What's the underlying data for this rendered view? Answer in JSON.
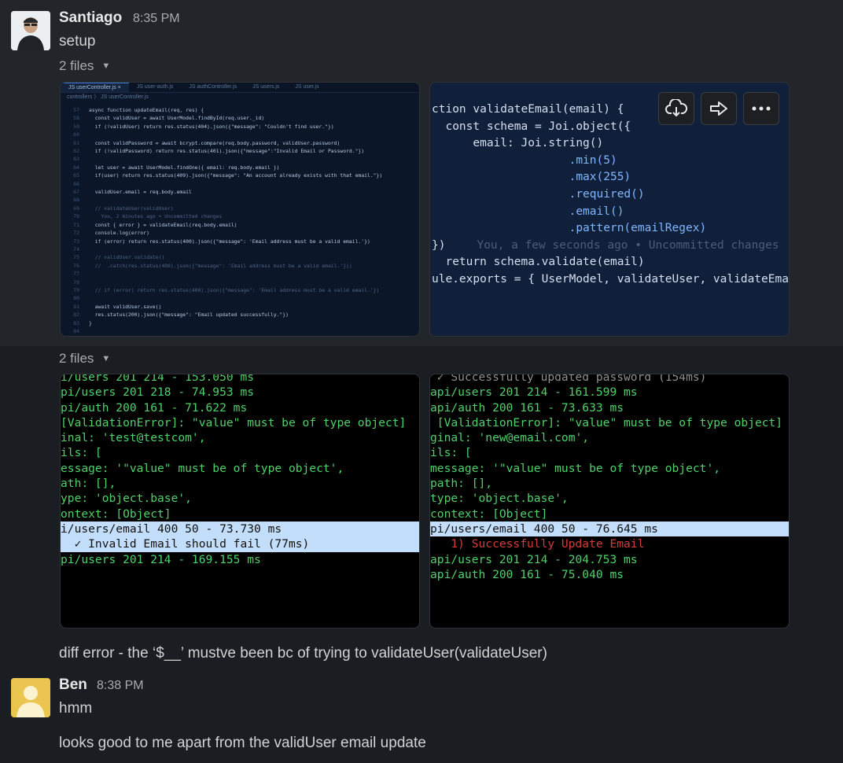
{
  "messages": [
    {
      "author": "Santiago",
      "time": "8:35 PM",
      "text": "setup"
    },
    {
      "text": "diff error - the ‘$__’ mustve been bc of trying to validateUser(validateUser)"
    },
    {
      "author": "Ben",
      "time": "8:38 PM",
      "text": "hmm"
    },
    {
      "text": "looks good to me apart from the validUser email update"
    }
  ],
  "file_groups": [
    {
      "label": "2 files"
    },
    {
      "label": "2 files"
    }
  ],
  "shot1": {
    "tabs": [
      "userController.js",
      "user-auth.js",
      "authController.js",
      "users.js",
      "user.js"
    ],
    "breadcrumb": "controllers 〉 JS userController.js",
    "lines": [
      {
        "n": "57",
        "t": "async function updateEmail(req, res) {"
      },
      {
        "n": "58",
        "t": "  const validUser = await UserModel.findById(req.user._id)"
      },
      {
        "n": "59",
        "t": "  if (!validUser) return res.status(404).json({\"message\": \"Couldn't find user.\"})"
      },
      {
        "n": "60",
        "t": ""
      },
      {
        "n": "61",
        "t": "  const validPassword = await bcrypt.compare(req.body.password, validUser.password)"
      },
      {
        "n": "62",
        "t": "  if (!validPassword) return res.status(401).json({\"message\":\"Invalid Email or Password.\"})"
      },
      {
        "n": "63",
        "t": ""
      },
      {
        "n": "64",
        "t": "  let user = await UserModel.findOne({ email: req.body.email })"
      },
      {
        "n": "65",
        "t": "  if(user) return res.status(409).json({\"message\": \"An account already exists with that email.\"})"
      },
      {
        "n": "66",
        "t": ""
      },
      {
        "n": "67",
        "t": "  validUser.email = req.body.email"
      },
      {
        "n": "68",
        "t": ""
      },
      {
        "n": "69",
        "t": "  // validateUser(validUser)"
      },
      {
        "n": "70",
        "t": "    You, 2 minutes ago • Uncommitted changes"
      },
      {
        "n": "71",
        "t": "  const { error } = validateEmail(req.body.email)"
      },
      {
        "n": "72",
        "t": "  console.log(error)"
      },
      {
        "n": "73",
        "t": "  if (error) return res.status(400).json({\"message\": 'Email address must be a valid email.'})"
      },
      {
        "n": "74",
        "t": ""
      },
      {
        "n": "75",
        "t": "  // validUser.validate()"
      },
      {
        "n": "76",
        "t": "  //  .catch(res.status(400).json({\"message\": 'Email address must be a valid email.'}))"
      },
      {
        "n": "77",
        "t": ""
      },
      {
        "n": "78",
        "t": ""
      },
      {
        "n": "79",
        "t": "  // if (error) return res.status(400).json({\"message\": 'Email address must be a valid email.'})"
      },
      {
        "n": "80",
        "t": ""
      },
      {
        "n": "81",
        "t": "  await validUser.save()"
      },
      {
        "n": "82",
        "t": "  res.status(200).json({\"message\": \"Email updated successfully.\"})"
      },
      {
        "n": "83",
        "t": "}"
      },
      {
        "n": "84",
        "t": ""
      }
    ]
  },
  "shot2": {
    "lines": [
      "ction validateEmail(email) {",
      "  const schema = Joi.object({",
      "      email: Joi.string()",
      "                    .min(5)",
      "                    .max(255)",
      "                    .required()",
      "                    .email()",
      "                    .pattern(emailRegex)",
      "})",
      "  return schema.validate(email)",
      "",
      "",
      "ule.exports = { UserModel, validateUser, validateEmai"
    ],
    "blame": "You, a few seconds ago • Uncommitted changes",
    "actions": [
      "download-icon",
      "share-icon",
      "more-icon"
    ]
  },
  "shot3": {
    "lines": [
      "i/users 201 214 - 153.050 ms",
      "pi/users 201 218 - 74.953 ms",
      "pi/auth 200 161 - 71.622 ms",
      "[ValidationError]: \"value\" must be of type object]",
      "inal: 'test@testcom',",
      "ils: [",
      "",
      "essage: '\"value\" must be of type object',",
      "ath: [],",
      "ype: 'object.base',",
      "ontext: [Object]",
      "",
      "",
      "",
      "i/users/email 400 50 - 73.730 ms",
      "  ✓ Invalid Email should fail (77ms)",
      "pi/users 201 214 - 169.155 ms"
    ]
  },
  "shot4": {
    "lines": [
      " ✓ Successfully updated password (154ms)",
      "api/users 201 214 - 161.599 ms",
      "api/auth 200 161 - 73.633 ms",
      " [ValidationError]: \"value\" must be of type object] {",
      "ginal: 'new@email.com',",
      "ils: [",
      "",
      "message: '\"value\" must be of type object',",
      "path: [],",
      "type: 'object.base',",
      "context: [Object]",
      "",
      "",
      "",
      "pi/users/email 400 50 - 76.645 ms",
      "   1) Successfully Update Email",
      "api/users 201 214 - 204.753 ms",
      "api/auth 200 161 - 75.040 ms"
    ]
  }
}
